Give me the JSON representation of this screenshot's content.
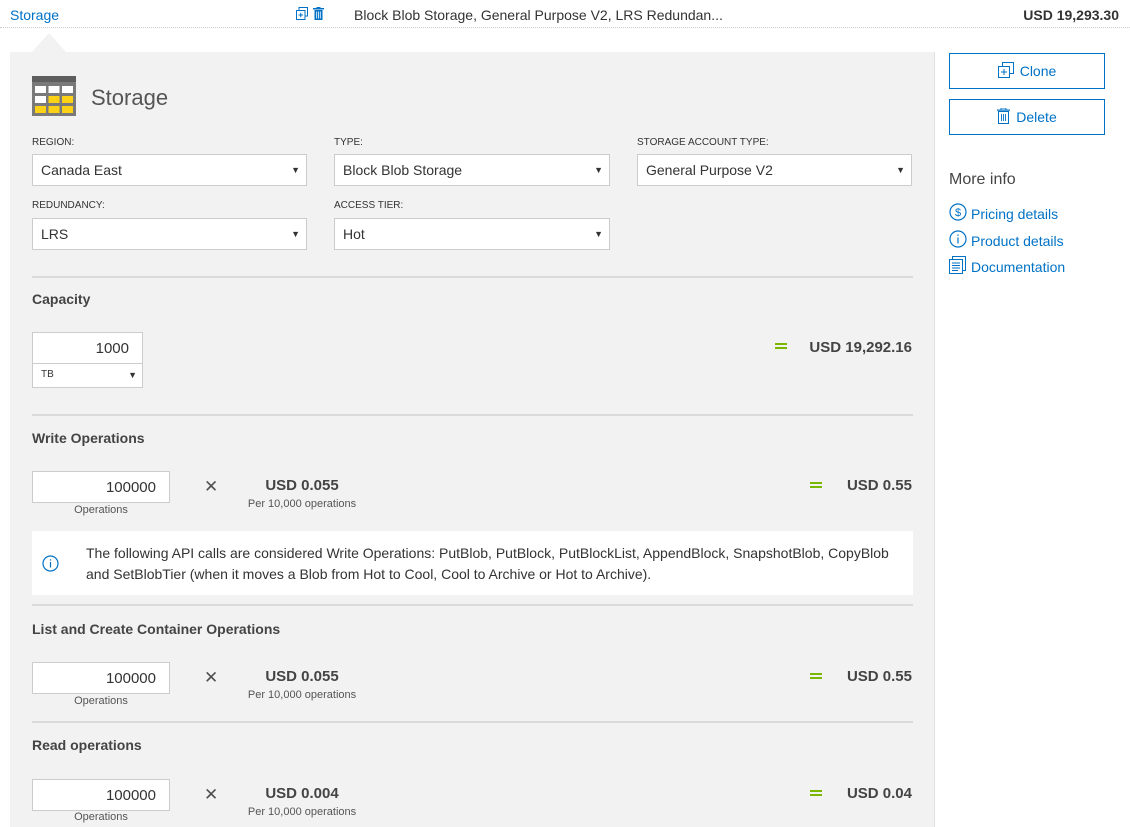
{
  "topbar": {
    "service_link": "Storage",
    "summary": "Block Blob Storage, General Purpose V2, LRS Redundan...",
    "total": "USD 19,293.30",
    "icons": [
      "clone-icon",
      "delete-icon"
    ]
  },
  "service": {
    "title": "Storage",
    "icon": "storage-icon"
  },
  "fields": {
    "region": {
      "label": "REGION:",
      "value": "Canada East"
    },
    "type": {
      "label": "TYPE:",
      "value": "Block Blob Storage"
    },
    "account_type": {
      "label": "STORAGE ACCOUNT TYPE:",
      "value": "General Purpose V2"
    },
    "redundancy": {
      "label": "REDUNDANCY:",
      "value": "LRS"
    },
    "access_tier": {
      "label": "ACCESS TIER:",
      "value": "Hot"
    }
  },
  "capacity": {
    "title": "Capacity",
    "quantity": "1000",
    "unit": "TB",
    "total": "USD 19,292.16"
  },
  "write_ops": {
    "title": "Write Operations",
    "quantity": "100000",
    "quantity_label": "Operations",
    "rate": "USD 0.055",
    "rate_sub": "Per 10,000 operations",
    "total": "USD 0.55",
    "info": "The following API calls are considered Write Operations: PutBlob, PutBlock, PutBlockList, AppendBlock, SnapshotBlob, CopyBlob and SetBlobTier (when it moves a Blob from Hot to Cool, Cool to Archive or Hot to Archive)."
  },
  "list_ops": {
    "title": "List and Create Container Operations",
    "quantity": "100000",
    "quantity_label": "Operations",
    "rate": "USD 0.055",
    "rate_sub": "Per 10,000 operations",
    "total": "USD 0.55"
  },
  "read_ops": {
    "title": "Read operations",
    "quantity": "100000",
    "quantity_label": "Operations",
    "rate": "USD 0.004",
    "rate_sub": "Per 10,000 operations",
    "total": "USD 0.04"
  },
  "sidebar": {
    "clone_label": "Clone",
    "delete_label": "Delete",
    "more_info_title": "More info",
    "links": {
      "pricing": "Pricing details",
      "product": "Product details",
      "docs": "Documentation"
    }
  },
  "colors": {
    "accent": "#0072c6",
    "equals": "#7ab800",
    "panel_bg": "#f2f2f2"
  }
}
